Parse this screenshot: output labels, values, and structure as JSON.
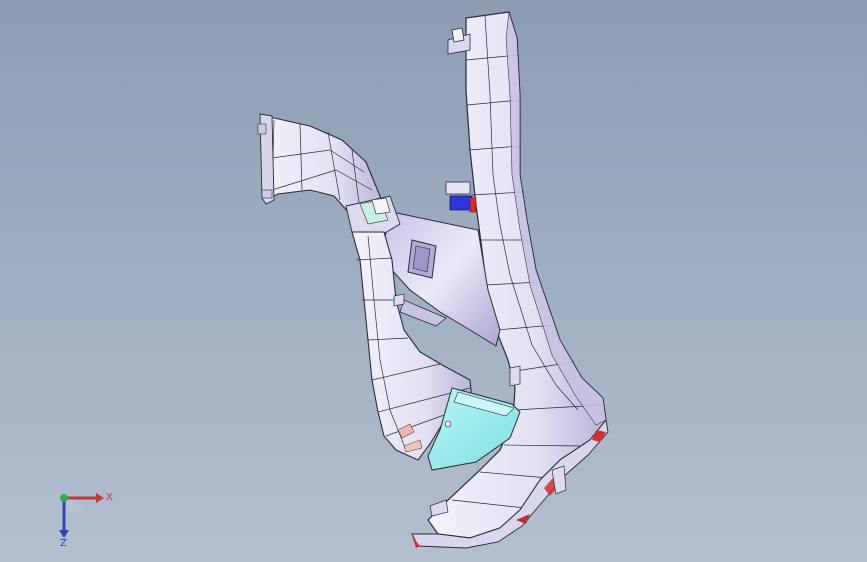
{
  "viewport": {
    "colors": {
      "background_top": "#8d9cb2",
      "background_bottom": "#b4c0d0",
      "part_surface": "#eceaf6",
      "part_shade": "#b7b3d8",
      "part_edge": "#2b2b3a",
      "filter_box": "#9ff0ef",
      "accent_red": "#d0302e",
      "accent_blue": "#2f35d6"
    }
  },
  "triad": {
    "x_label": "X",
    "z_label": "Z",
    "x_color": "#c0393b",
    "y_color": "#2fa84f",
    "z_color": "#3a3fb8"
  }
}
